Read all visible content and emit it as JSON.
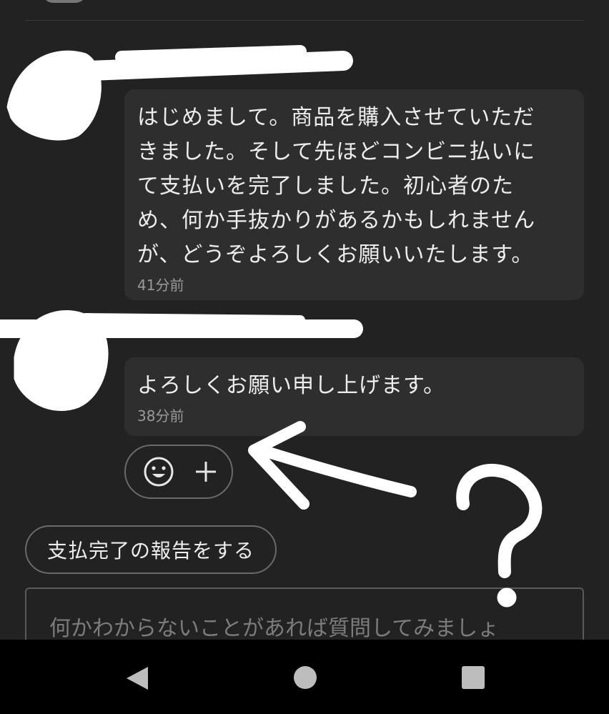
{
  "messages": [
    {
      "text": "はじめまして。商品を購入させていただきました。そして先ほどコンビニ払いにて支払いを完了しました。初心者のため、何か手抜かりがあるかもしれませんが、どうぞよろしくお願いいたします。",
      "lines": [
        "はじめまして。商品を購入させていただ",
        "きました。そして先ほどコンビニ払いに",
        "て支払いを完了しました。初心者のた",
        "め、何か手抜かりがあるかもしれません",
        "が、どうぞよろしくお願いいたします。"
      ],
      "time": "41分前"
    },
    {
      "text": "よろしくお願い申し上げます。",
      "time": "38分前"
    }
  ],
  "reaction": {
    "smile_icon": "smiley-face-icon",
    "add_icon": "plus-icon"
  },
  "actions": {
    "report_payment_label": "支払完了の報告をする"
  },
  "composer": {
    "placeholder": "何かわからないことがあれば質問してみましょ"
  },
  "annotation": {
    "mark": "?"
  },
  "navbar": {
    "back_icon": "back-triangle-icon",
    "home_icon": "home-circle-icon",
    "recent_icon": "recent-square-icon"
  }
}
